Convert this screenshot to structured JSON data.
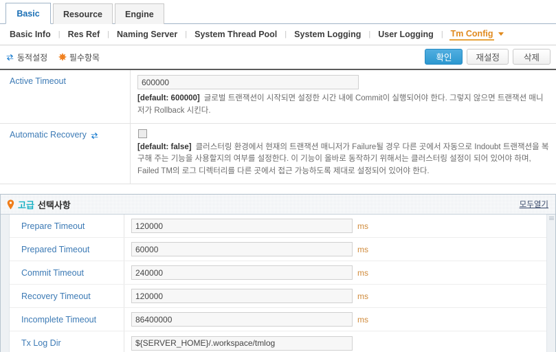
{
  "tabs": [
    {
      "label": "Basic",
      "active": true
    },
    {
      "label": "Resource",
      "active": false
    },
    {
      "label": "Engine",
      "active": false
    }
  ],
  "subnav": {
    "items": [
      {
        "label": "Basic Info",
        "current": false
      },
      {
        "label": "Res Ref",
        "current": false
      },
      {
        "label": "Naming Server",
        "current": false
      },
      {
        "label": "System Thread Pool",
        "current": false
      },
      {
        "label": "System Logging",
        "current": false
      },
      {
        "label": "User Logging",
        "current": false
      },
      {
        "label": "Tm Config",
        "current": true
      }
    ],
    "separator": "|"
  },
  "actionbar": {
    "legend": [
      {
        "icon": "sync-icon",
        "label": "동적설정"
      },
      {
        "icon": "asterisk-icon",
        "label": "필수항목"
      }
    ],
    "buttons": [
      {
        "label": "확인",
        "style": "primary"
      },
      {
        "label": "재설정",
        "style": "default"
      },
      {
        "label": "삭제",
        "style": "default"
      }
    ]
  },
  "basic_rows": [
    {
      "label": "Active Timeout",
      "dynamic": false,
      "type": "text",
      "value": "600000",
      "default_text": "[default: 600000]",
      "description": "글로벌 트랜잭션이 시작되면 설정한 시간 내에 Commit이 실행되어야 한다. 그렇지 않으면 트랜잭션 매니저가 Rollback 시킨다."
    },
    {
      "label": "Automatic Recovery",
      "dynamic": true,
      "type": "checkbox",
      "checked": false,
      "default_text": "[default: false]",
      "description": "클러스터링 환경에서 현재의 트랜잭션 매니저가 Failure될 경우 다른 곳에서 자동으로 Indoubt 트랜잭션을 복구해 주는 기능을 사용할지의 여부를 설정한다. 이 기능이 올바로 동작하기 위해서는 클러스터링 설정이 되어 있어야 하며, Failed TM의 로그 디렉터리를 다른 곳에서 접근 가능하도록 제대로 설정되어 있어야 한다."
    }
  ],
  "advanced": {
    "title_highlight": "고급",
    "title_rest": "선택사항",
    "expand_all_label": "모두열기",
    "rows": [
      {
        "label": "Prepare Timeout",
        "value": "120000",
        "unit": "ms"
      },
      {
        "label": "Prepared Timeout",
        "value": "60000",
        "unit": "ms"
      },
      {
        "label": "Commit Timeout",
        "value": "240000",
        "unit": "ms"
      },
      {
        "label": "Recovery Timeout",
        "value": "120000",
        "unit": "ms"
      },
      {
        "label": "Incomplete Timeout",
        "value": "86400000",
        "unit": "ms"
      },
      {
        "label": "Tx Log Dir",
        "value": "${SERVER_HOME}/.workspace/tmlog",
        "unit": ""
      }
    ]
  },
  "colors": {
    "accent_blue": "#3c7ab5",
    "accent_orange": "#e08a1e",
    "primary_button": "#2d98d0",
    "unit_text": "#d08a3a",
    "adv_highlight": "#19b0c4"
  }
}
